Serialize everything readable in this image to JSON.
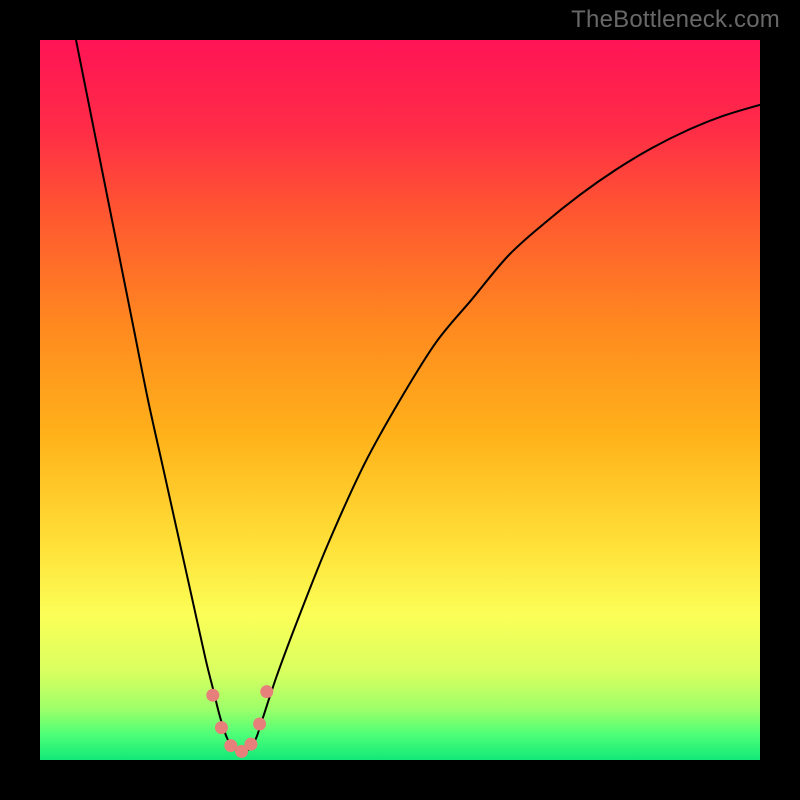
{
  "watermark": "TheBottleneck.com",
  "colors": {
    "frame_bg": "#000000",
    "curve_stroke": "#000000",
    "marker_fill": "#e77f7a",
    "marker_stroke": "#c9605d"
  },
  "chart_data": {
    "type": "line",
    "title": "",
    "xlabel": "",
    "ylabel": "",
    "xlim": [
      0,
      100
    ],
    "ylim": [
      0,
      100
    ],
    "gradient_stops": [
      {
        "offset": 0.0,
        "color": "#ff1455"
      },
      {
        "offset": 0.12,
        "color": "#ff2b48"
      },
      {
        "offset": 0.25,
        "color": "#ff5a2f"
      },
      {
        "offset": 0.4,
        "color": "#ff8a1f"
      },
      {
        "offset": 0.55,
        "color": "#ffb21a"
      },
      {
        "offset": 0.7,
        "color": "#ffe038"
      },
      {
        "offset": 0.8,
        "color": "#fbff57"
      },
      {
        "offset": 0.88,
        "color": "#d7ff60"
      },
      {
        "offset": 0.93,
        "color": "#9cff69"
      },
      {
        "offset": 0.965,
        "color": "#4dff78"
      },
      {
        "offset": 1.0,
        "color": "#12e878"
      }
    ],
    "series": [
      {
        "name": "bottleneck-curve",
        "x": [
          5,
          7,
          9,
          11,
          13,
          15,
          17,
          19,
          21,
          23,
          24,
          25,
          26,
          27,
          28,
          29,
          30,
          31,
          33,
          36,
          40,
          45,
          50,
          55,
          60,
          65,
          70,
          75,
          80,
          85,
          90,
          95,
          100
        ],
        "y": [
          100,
          90,
          80,
          70,
          60,
          50,
          41,
          32,
          23,
          14,
          10,
          6,
          3,
          1.5,
          1.2,
          1.5,
          3,
          6,
          12,
          20,
          30,
          41,
          50,
          58,
          64,
          70,
          74.5,
          78.5,
          82,
          85,
          87.5,
          89.5,
          91
        ]
      }
    ],
    "markers": [
      {
        "x": 24.0,
        "y": 9.0
      },
      {
        "x": 25.2,
        "y": 4.5
      },
      {
        "x": 26.5,
        "y": 2.0
      },
      {
        "x": 28.0,
        "y": 1.2
      },
      {
        "x": 29.3,
        "y": 2.2
      },
      {
        "x": 30.5,
        "y": 5.0
      },
      {
        "x": 31.5,
        "y": 9.5
      }
    ]
  }
}
